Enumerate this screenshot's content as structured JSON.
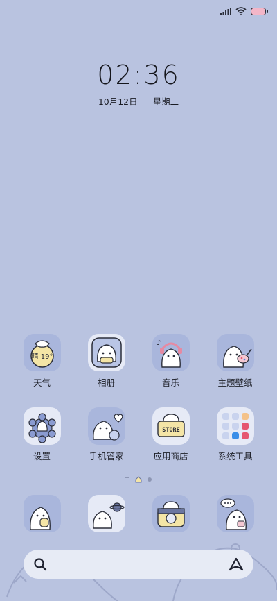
{
  "status": {
    "icons": [
      "signal-icon",
      "wifi-icon",
      "battery-icon"
    ]
  },
  "clock": {
    "time": "02:36",
    "date": "10月12日",
    "weekday": "星期二"
  },
  "apps_row1": [
    {
      "label": "天气",
      "icon": "weather-icon",
      "weather_text": "晴 19°"
    },
    {
      "label": "相册",
      "icon": "gallery-icon"
    },
    {
      "label": "音乐",
      "icon": "music-icon"
    },
    {
      "label": "主题壁纸",
      "icon": "themes-icon"
    }
  ],
  "apps_row2": [
    {
      "label": "设置",
      "icon": "settings-icon"
    },
    {
      "label": "手机管家",
      "icon": "security-icon"
    },
    {
      "label": "应用商店",
      "icon": "app-store-icon",
      "store_text": "STORE"
    },
    {
      "label": "系统工具",
      "icon": "system-tools-folder-icon"
    }
  ],
  "dock": [
    {
      "icon": "phone-icon"
    },
    {
      "icon": "browser-icon"
    },
    {
      "icon": "camera-icon"
    },
    {
      "icon": "messages-icon"
    }
  ],
  "page_indicator": {
    "pages": 2,
    "current": 1
  },
  "search_bar": {
    "left_icon": "search-icon",
    "right_icon": "assistant-icon"
  },
  "colors": {
    "background": "#b9c3e0",
    "icon_tile": "#a9b6dc",
    "search_bg": "#e7ebf5"
  }
}
